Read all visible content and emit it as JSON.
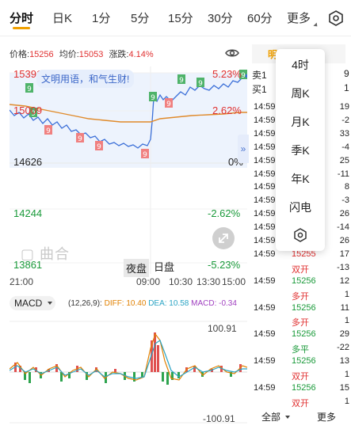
{
  "tabs": {
    "items": [
      "分时",
      "日K",
      "1分",
      "5分",
      "15分",
      "30分",
      "60分",
      "更多"
    ],
    "active": 0
  },
  "info": {
    "price_label": "价格:",
    "price": "15256",
    "avg_label": "均价:",
    "avg": "15053",
    "change_label": "涨跌:",
    "change": "4.14%"
  },
  "chart": {
    "left_labels": [
      "15391",
      "15009",
      "14626",
      "14244",
      "13861"
    ],
    "right_labels": [
      "5.23%",
      "2.62%",
      "0%",
      "-2.62%",
      "-5.23%"
    ],
    "bubble": "文明用语，和气生财!",
    "watermark": "曲合",
    "session_night": "夜盘",
    "session_day": "日盘",
    "time_axis": [
      "21:00",
      "09:00",
      "10:30",
      "13:30",
      "15:00"
    ]
  },
  "macd": {
    "indicator": "MACD",
    "params": "(12,26,9):",
    "diff": "DIFF: 10.40",
    "dea": "DEA: 10.58",
    "macd": "MACD: -0.34",
    "top": "100.91",
    "bottom": "-100.91"
  },
  "panel": {
    "tab": "明",
    "sell_label": "卖1",
    "buy_label": "买1",
    "sell_vol": "9",
    "buy_vol": "1"
  },
  "trades": [
    {
      "time": "14:59",
      "price": "",
      "vol": "19"
    },
    {
      "time": "14:59",
      "price": "",
      "vol": "-2"
    },
    {
      "time": "14:59",
      "price": "",
      "vol": "33"
    },
    {
      "time": "14:59",
      "price": "",
      "vol": "-4"
    },
    {
      "time": "14:59",
      "price": "",
      "vol": "25"
    },
    {
      "time": "14:59",
      "price": "",
      "vol": "-11"
    },
    {
      "time": "14:59",
      "price": "",
      "vol": "8"
    },
    {
      "time": "14:59",
      "price": "",
      "vol": "-3"
    },
    {
      "time": "14:59",
      "price": "",
      "vol": "26"
    },
    {
      "time": "14:59",
      "price": "",
      "vol": "-14"
    },
    {
      "time": "14:59",
      "price": "",
      "vol": "26"
    },
    {
      "time": "14:59",
      "price": "15255",
      "vol": "17"
    },
    {
      "time": "",
      "price": "双开",
      "vol": "-13"
    },
    {
      "time": "14:59",
      "price": "15256",
      "vol": "12"
    },
    {
      "time": "",
      "price": "多开",
      "vol": "1"
    },
    {
      "time": "14:59",
      "price": "15256",
      "vol": "11"
    },
    {
      "time": "",
      "price": "多开",
      "vol": "1"
    },
    {
      "time": "14:59",
      "price": "15256",
      "vol": "29"
    },
    {
      "time": "",
      "price": "多平",
      "vol": "-22"
    },
    {
      "time": "14:59",
      "price": "15256",
      "vol": "13"
    },
    {
      "time": "",
      "price": "双开",
      "vol": "1"
    },
    {
      "time": "14:59",
      "price": "15256",
      "vol": "15"
    },
    {
      "time": "",
      "price": "双开",
      "vol": "1"
    }
  ],
  "footer": {
    "all": "全部",
    "more": "更多"
  },
  "popup": {
    "items": [
      "4时",
      "周K",
      "月K",
      "季K",
      "年K",
      "闪电"
    ]
  }
}
